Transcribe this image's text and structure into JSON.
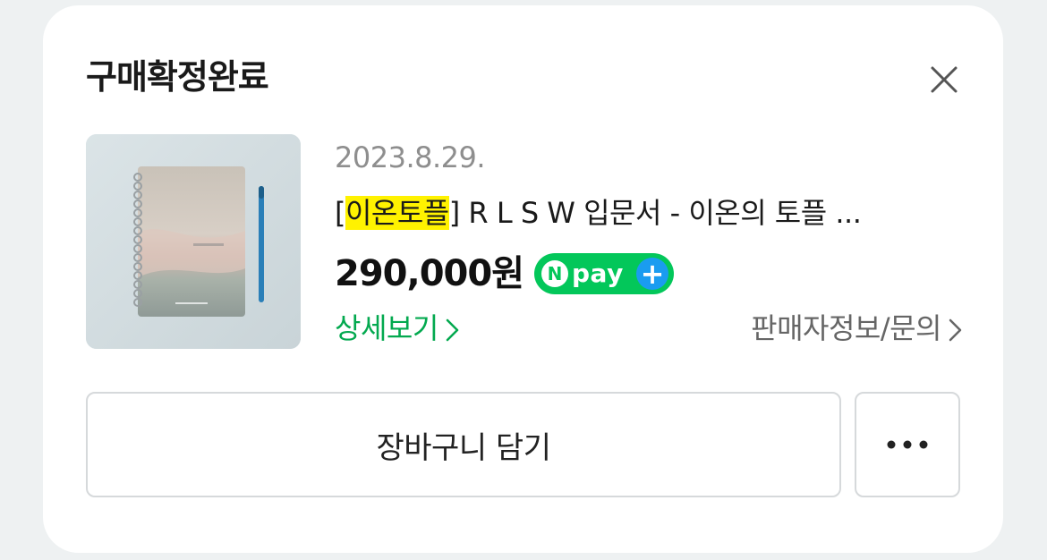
{
  "dialog": {
    "title": "구매확정완료",
    "close_icon": "close-icon"
  },
  "order": {
    "date": "2023.8.29.",
    "product_name_prefix": "[",
    "product_name_highlight": "이온토플",
    "product_name_rest": "] R L S W 입문서 - 이온의 토플 ...",
    "price": "290,000원",
    "npay_badge": {
      "letter": "N",
      "label": "pay",
      "plus": "+"
    },
    "detail_link": "상세보기",
    "seller_link": "판매자정보/문의",
    "thumbnail_icon": "notebook-thumbnail"
  },
  "actions": {
    "cart_label": "장바구니 담기",
    "more_icon": "more-dots-icon"
  },
  "colors": {
    "accent_green": "#03c75a",
    "link_green": "#03a94f",
    "highlight": "#fff200",
    "npay_plus_blue": "#1a9cf0"
  }
}
